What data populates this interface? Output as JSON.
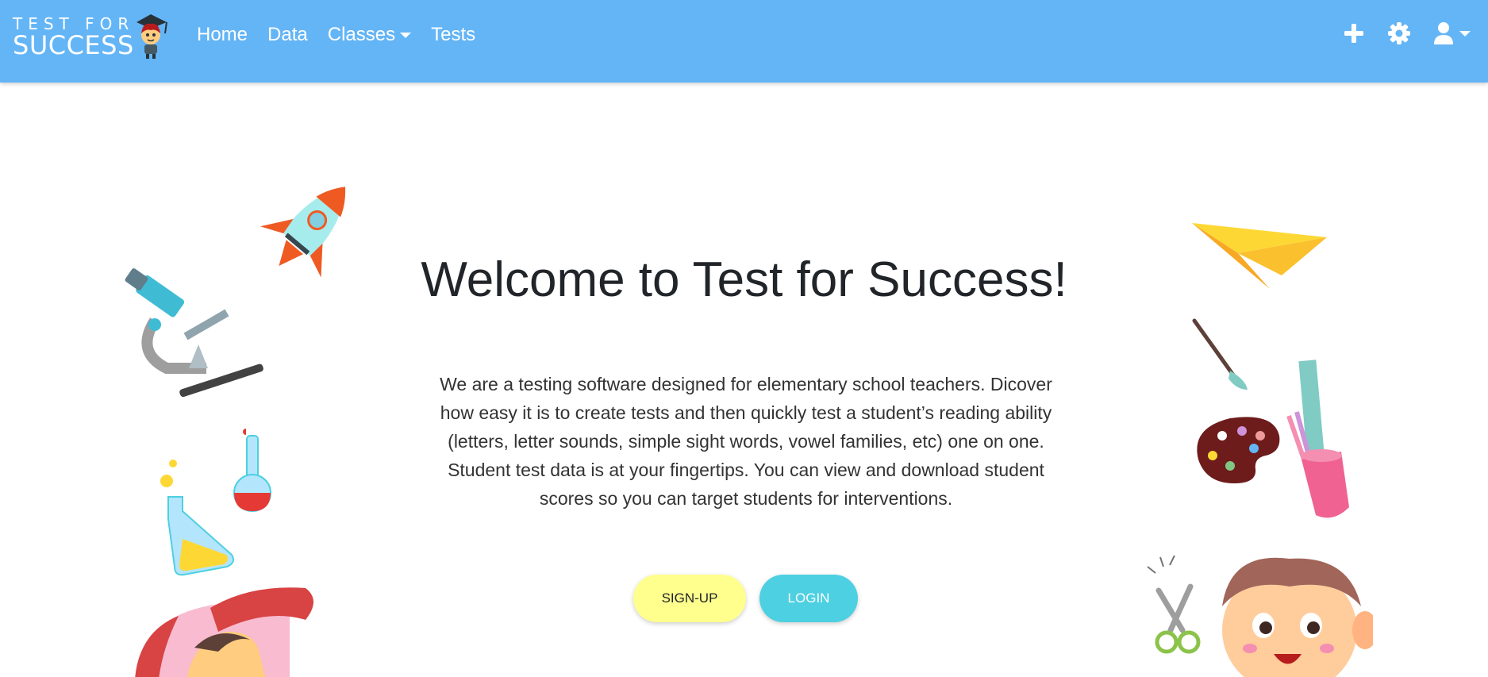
{
  "brand": {
    "top": "TEST FOR",
    "bottom": "SUCCESS"
  },
  "nav": {
    "home": "Home",
    "data": "Data",
    "classes": "Classes",
    "tests": "Tests"
  },
  "icons": {
    "add": "plus-icon",
    "settings": "gear-icon",
    "user": "user-icon"
  },
  "hero": {
    "title": "Welcome to Test for Success!",
    "description": "We are a testing software designed for elementary school teachers. Dicover how easy it is to create tests and then quickly test a student’s reading ability (letters, letter sounds, simple sight words, vowel families, etc) one on one. Student test data is at your fingertips. You can view and download student scores so you can target students for interventions.",
    "signup": "SIGN-UP",
    "login": "LOGIN"
  },
  "colors": {
    "navbar": "#64b5f6",
    "signup": "#ffff8d",
    "login": "#4dd0e1"
  }
}
